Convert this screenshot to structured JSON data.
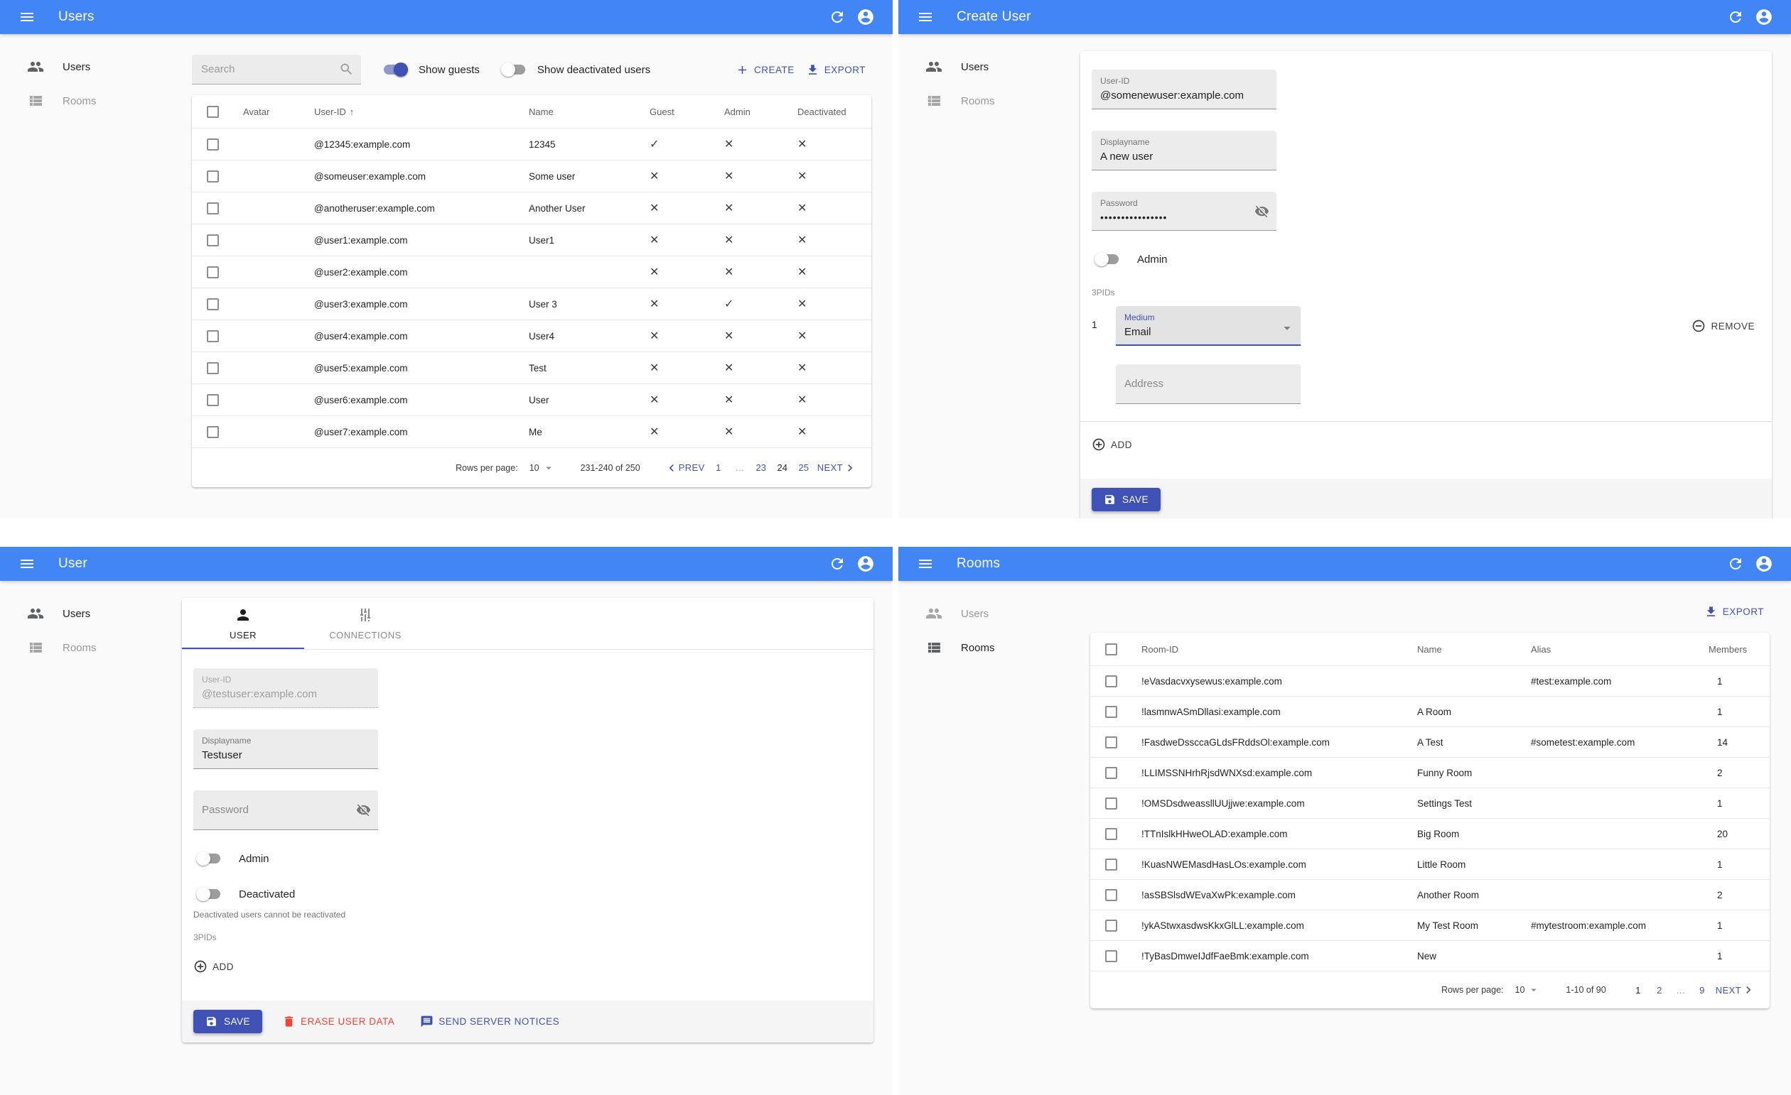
{
  "users_panel": {
    "title": "Users",
    "sidebar": {
      "users": "Users",
      "rooms": "Rooms"
    },
    "search_placeholder": "Search",
    "show_guests_label": "Show guests",
    "show_deactivated_label": "Show deactivated users",
    "create_label": "CREATE",
    "export_label": "EXPORT",
    "table": {
      "headers": {
        "avatar": "Avatar",
        "user_id": "User-ID",
        "sort_arrow": "↑",
        "name": "Name",
        "guest": "Guest",
        "admin": "Admin",
        "deactivated": "Deactivated"
      },
      "rows": [
        {
          "user_id": "@12345:example.com",
          "name": "12345",
          "guest": "check",
          "admin": "x",
          "deactivated": "x"
        },
        {
          "user_id": "@someuser:example.com",
          "name": "Some user",
          "guest": "x",
          "admin": "x",
          "deactivated": "x"
        },
        {
          "user_id": "@anotheruser:example.com",
          "name": "Another User",
          "guest": "x",
          "admin": "x",
          "deactivated": "x"
        },
        {
          "user_id": "@user1:example.com",
          "name": "User1",
          "guest": "x",
          "admin": "x",
          "deactivated": "x"
        },
        {
          "user_id": "@user2:example.com",
          "name": "",
          "guest": "x",
          "admin": "x",
          "deactivated": "x"
        },
        {
          "user_id": "@user3:example.com",
          "name": "User 3",
          "guest": "x",
          "admin": "check",
          "deactivated": "x"
        },
        {
          "user_id": "@user4:example.com",
          "name": "User4",
          "guest": "x",
          "admin": "x",
          "deactivated": "x"
        },
        {
          "user_id": "@user5:example.com",
          "name": "Test",
          "guest": "x",
          "admin": "x",
          "deactivated": "x"
        },
        {
          "user_id": "@user6:example.com",
          "name": "User",
          "guest": "x",
          "admin": "x",
          "deactivated": "x"
        },
        {
          "user_id": "@user7:example.com",
          "name": "Me",
          "guest": "x",
          "admin": "x",
          "deactivated": "x"
        }
      ]
    },
    "pagination": {
      "rows_per_page_label": "Rows per page:",
      "rows_per_page": "10",
      "range": "231-240 of 250",
      "prev_label": "PREV",
      "next_label": "NEXT",
      "pages": [
        {
          "label": "1"
        },
        {
          "label": "…",
          "ellipsis": true
        },
        {
          "label": "23"
        },
        {
          "label": "24",
          "current": true
        },
        {
          "label": "25"
        }
      ]
    }
  },
  "create_panel": {
    "title": "Create User",
    "sidebar": {
      "users": "Users",
      "rooms": "Rooms"
    },
    "user_id_label": "User-ID",
    "user_id_value": "@somenewuser:example.com",
    "displayname_label": "Displayname",
    "displayname_value": "A new user",
    "password_label": "Password",
    "password_value": "••••••••••••••••",
    "admin_label": "Admin",
    "threepids_label": "3PIDs",
    "threepid_index": "1",
    "medium_label": "Medium",
    "medium_value": "Email",
    "remove_label": "REMOVE",
    "address_placeholder": "Address",
    "add_label": "ADD",
    "save_label": "SAVE"
  },
  "user_panel": {
    "title": "User",
    "sidebar": {
      "users": "Users",
      "rooms": "Rooms"
    },
    "tabs": {
      "user": "USER",
      "connections": "CONNECTIONS"
    },
    "user_id_label": "User-ID",
    "user_id_value": "@testuser:example.com",
    "displayname_label": "Displayname",
    "displayname_value": "Testuser",
    "password_placeholder": "Password",
    "admin_label": "Admin",
    "deactivated_label": "Deactivated",
    "deactivated_note": "Deactivated users cannot be reactivated",
    "threepids_label": "3PIDs",
    "add_label": "ADD",
    "save_label": "SAVE",
    "erase_label": "ERASE USER DATA",
    "send_notices_label": "SEND SERVER NOTICES"
  },
  "rooms_panel": {
    "title": "Rooms",
    "sidebar": {
      "users": "Users",
      "rooms": "Rooms"
    },
    "export_label": "EXPORT",
    "table": {
      "headers": {
        "room_id": "Room-ID",
        "name": "Name",
        "alias": "Alias",
        "members": "Members"
      },
      "rows": [
        {
          "room_id": "!eVasdacvxysewus:example.com",
          "name": "",
          "alias": "#test:example.com",
          "members": "1"
        },
        {
          "room_id": "!lasmnwASmDllasi:example.com",
          "name": "A Room",
          "alias": "",
          "members": "1"
        },
        {
          "room_id": "!FasdweDssccaGLdsFRddsOl:example.com",
          "name": "A Test",
          "alias": "#sometest:example.com",
          "members": "14"
        },
        {
          "room_id": "!LLIMSSNHrhRjsdWNXsd:example.com",
          "name": "Funny Room",
          "alias": "",
          "members": "2"
        },
        {
          "room_id": "!OMSDsdweassllUUjjwe:example.com",
          "name": "Settings Test",
          "alias": "",
          "members": "1"
        },
        {
          "room_id": "!TTnIslkHHweOLAD:example.com",
          "name": "Big Room",
          "alias": "",
          "members": "20"
        },
        {
          "room_id": "!KuasNWEMasdHasLOs:example.com",
          "name": "Little Room",
          "alias": "",
          "members": "1"
        },
        {
          "room_id": "!asSBSlsdWEvaXwPk:example.com",
          "name": "Another Room",
          "alias": "",
          "members": "2"
        },
        {
          "room_id": "!ykAStwxasdwsKkxGlLL:example.com",
          "name": "My Test Room",
          "alias": "#mytestroom:example.com",
          "members": "1"
        },
        {
          "room_id": "!TyBasDmweIJdfFaeBmk:example.com",
          "name": "New",
          "alias": "",
          "members": "1"
        }
      ]
    },
    "pagination": {
      "rows_per_page_label": "Rows per page:",
      "rows_per_page": "10",
      "range": "1-10 of 90",
      "next_label": "NEXT",
      "pages": [
        {
          "label": "1",
          "current": true
        },
        {
          "label": "2"
        },
        {
          "label": "…",
          "ellipsis": true
        },
        {
          "label": "9"
        }
      ]
    }
  }
}
